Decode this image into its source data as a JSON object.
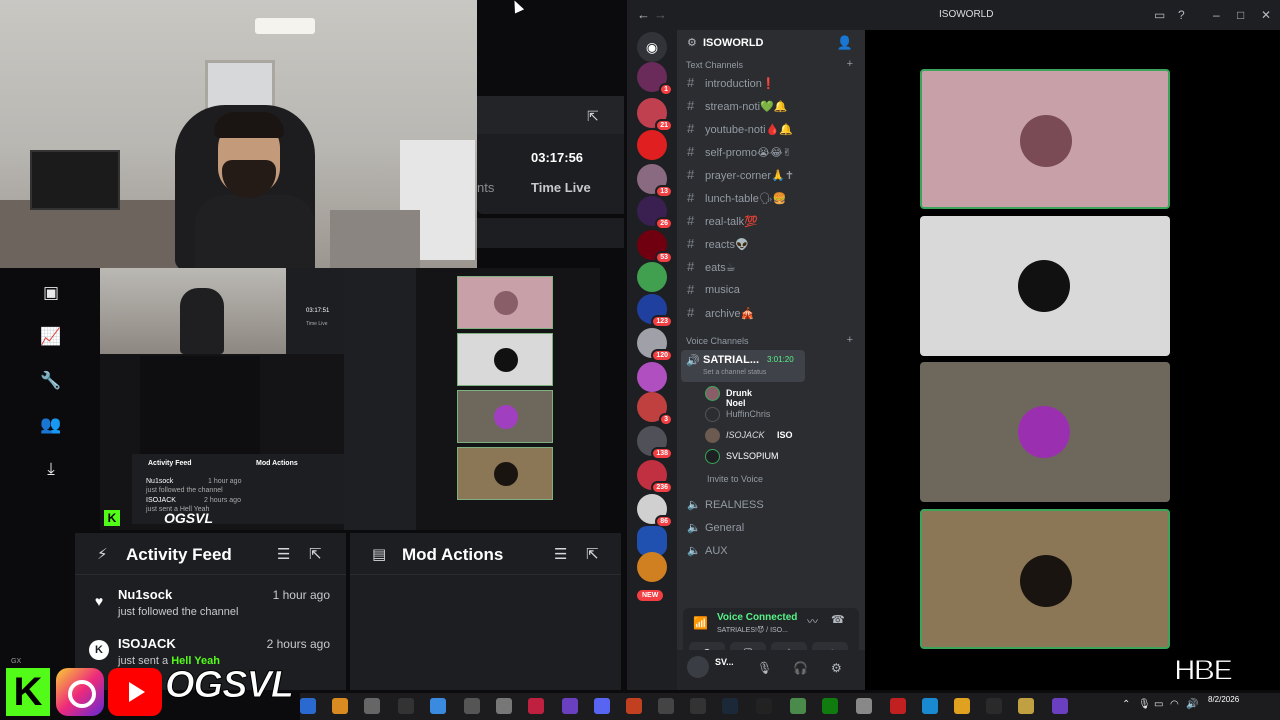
{
  "dashboard": {
    "stream_time": "03:17:56",
    "stream_time_label": "Time Live",
    "truncated_label": "nts"
  },
  "nested_preview": {
    "time": "03:17:51",
    "time_label": "Time Live",
    "activity_title": "Activity Feed",
    "mod_title": "Mod Actions",
    "feed_user1": "Nu1sock",
    "feed_user1_time": "1 hour ago",
    "feed_user1_action": "just followed the channel",
    "feed_user2": "ISOJACK",
    "feed_user2_time": "2 hours ago",
    "feed_user2_action": "just sent a Hell Yeah",
    "brand_name": "OGSVL"
  },
  "activity_feed": {
    "title": "Activity Feed",
    "items": [
      {
        "name": "Nu1sock",
        "time": "1 hour ago",
        "action": "just followed the channel",
        "highlight": ""
      },
      {
        "name": "ISOJACK",
        "time": "2 hours ago",
        "action": "just sent a ",
        "highlight": "Hell Yeah"
      }
    ]
  },
  "mod_actions": {
    "title": "Mod Actions"
  },
  "brand": {
    "gx": "GX",
    "k": "K",
    "name": "OGSVL"
  },
  "discord": {
    "window_title": "ISOWORLD",
    "server_name": "ISOWORLD",
    "text_category": "Text Channels",
    "voice_category": "Voice Channels",
    "text_channels": [
      "introduction❗",
      "stream-noti💚🔔",
      "youtube-noti🩸🔔",
      "self-promo😭😂✌",
      "prayer-corner🙏✝",
      "lunch-table🗣🍔",
      "real-talk💯",
      "reacts👽",
      "eats☕",
      "musica",
      "archive🎪"
    ],
    "active_voice": {
      "name": "SATRIAL...",
      "time": "3:01:20",
      "status": "Set a channel status"
    },
    "voice_users": [
      {
        "name": "Drunk Noel",
        "color": "#ffffff"
      },
      {
        "name": "HuffinChris",
        "color": "#949ba4"
      },
      {
        "name": "ISOJACK",
        "color": "#dbdee1",
        "tag": "ISO"
      },
      {
        "name": "SVLSOPIUM",
        "color": "#ffffff"
      }
    ],
    "invite_label": "Invite to Voice",
    "other_voice": [
      "REALNESS",
      "General",
      "AUX"
    ],
    "voice_connected": "Voice Connected",
    "voice_sub": "SATRIALES!😈 / ISO...",
    "user_short": "SV...",
    "guild_counts": [
      "1",
      "21",
      "13",
      "26",
      "53",
      "123",
      "120",
      "3",
      "138",
      "236",
      "86"
    ],
    "new_label": "NEW"
  },
  "taskbar": {
    "date": "8/2/2026"
  },
  "watermark": "HBE",
  "colors": {
    "speaking_border": "#3ba55c",
    "kick_green": "#53fc18",
    "discord_red": "#f23f43",
    "tile_pink": "#c7a0a8",
    "tile_light": "#d9d9d9",
    "tile_gray": "#6e685c",
    "tile_tan": "#8b7755"
  }
}
